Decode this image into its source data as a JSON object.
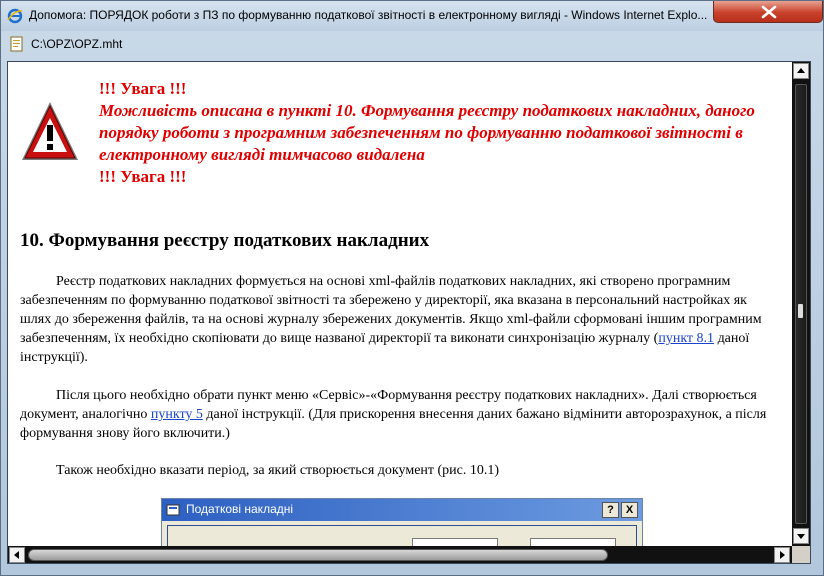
{
  "window": {
    "title": "Допомога: ПОРЯДОК роботи з ПЗ по формуванню податкової звітності в електронному вигляді - Windows Internet Explo..."
  },
  "address": {
    "path": "C:\\OPZ\\OPZ.mht"
  },
  "warning": {
    "head": "!!! Увага !!!",
    "body": "Можливість описана в пункті 10. Формування реєстру податкових накладних, даного порядку роботи з програмним забезпеченням по формуванню податкової звітності в електронному вигляді тимчасово видалена",
    "tail": "!!! Увага !!!"
  },
  "section": {
    "heading": "10. Формування реєстру податкових накладних"
  },
  "paragraph1": {
    "text_a": "Реєстр податкових накладних формується на основі xml-файлів податкових накладних, які створено програмним забезпеченням по формуванню податкової звітності та збережено у директорії, яка вказана в персональний настройках як шлях до збереження файлів, та на основі журналу збережених документів. Якщо xml-файли сформовані іншим програмним забезпеченням, їх необхідно скопіювати до вище названої директорії та виконати синхронізацію журналу (",
    "link": "пункт 8.1",
    "text_b": " даної інструкції)."
  },
  "paragraph2": {
    "text_a": "Після цього необхідно обрати пункт меню «Сервіс»-«Формування реєстру податкових накладних». Далі створюється документ, аналогічно ",
    "link": "пункту 5",
    "text_b": " даної інструкції. (Для прискорення внесення даних бажано відмінити авторозрахунок, а після формування знову його включити.)"
  },
  "paragraph3": {
    "text": "Також необхідно вказати період, за який створюється документ (рис. 10.1)"
  },
  "dialog": {
    "title": "Податкові накладні",
    "help_label": "?",
    "close_label": "X"
  },
  "colors": {
    "warning_text": "#e00000",
    "link": "#1a44c9"
  }
}
